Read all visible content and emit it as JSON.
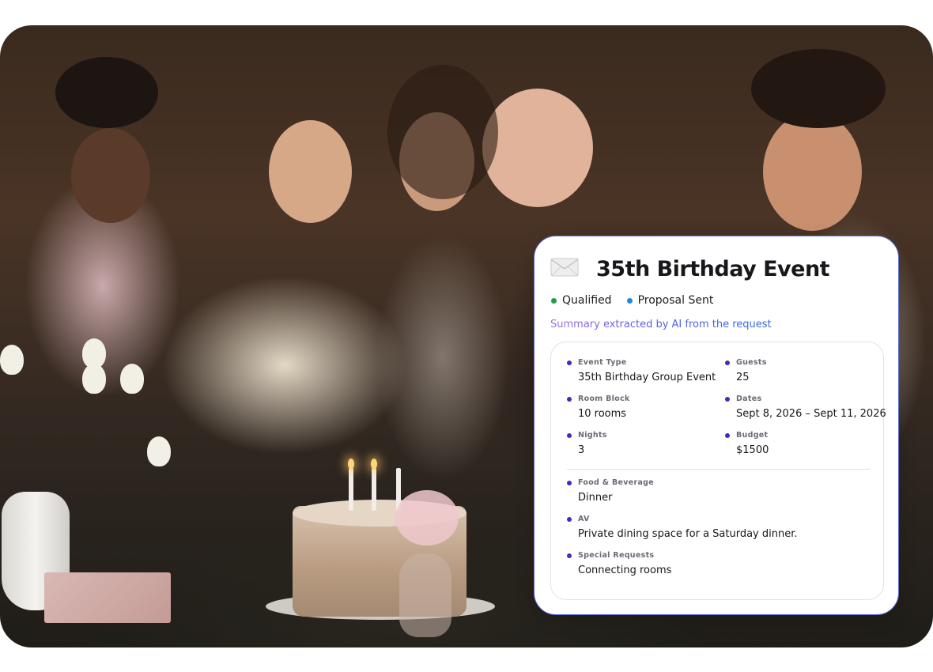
{
  "card": {
    "icon": "envelope-icon",
    "title": "35th Birthday Event",
    "statuses": [
      {
        "label": "Qualified",
        "color": "#1f9d4c"
      },
      {
        "label": "Proposal Sent",
        "color": "#1a8be8"
      }
    ],
    "summary_label": "Summary extracted by AI from the request",
    "fields": {
      "event_type": {
        "label": "Event Type",
        "value": "35th Birthday Group Event"
      },
      "guests": {
        "label": "Guests",
        "value": "25"
      },
      "room_block": {
        "label": "Room Block",
        "value": "10 rooms"
      },
      "dates": {
        "label": "Dates",
        "value": "Sept 8, 2026 – Sept 11, 2026"
      },
      "nights": {
        "label": "Nights",
        "value": "3"
      },
      "budget": {
        "label": "Budget",
        "value": "$1500"
      },
      "food_beverage": {
        "label": "Food & Beverage",
        "value": "Dinner"
      },
      "av": {
        "label": "AV",
        "value": "Private dining space for a Saturday dinner."
      },
      "special_requests": {
        "label": "Special Requests",
        "value": "Connecting rooms"
      }
    }
  }
}
